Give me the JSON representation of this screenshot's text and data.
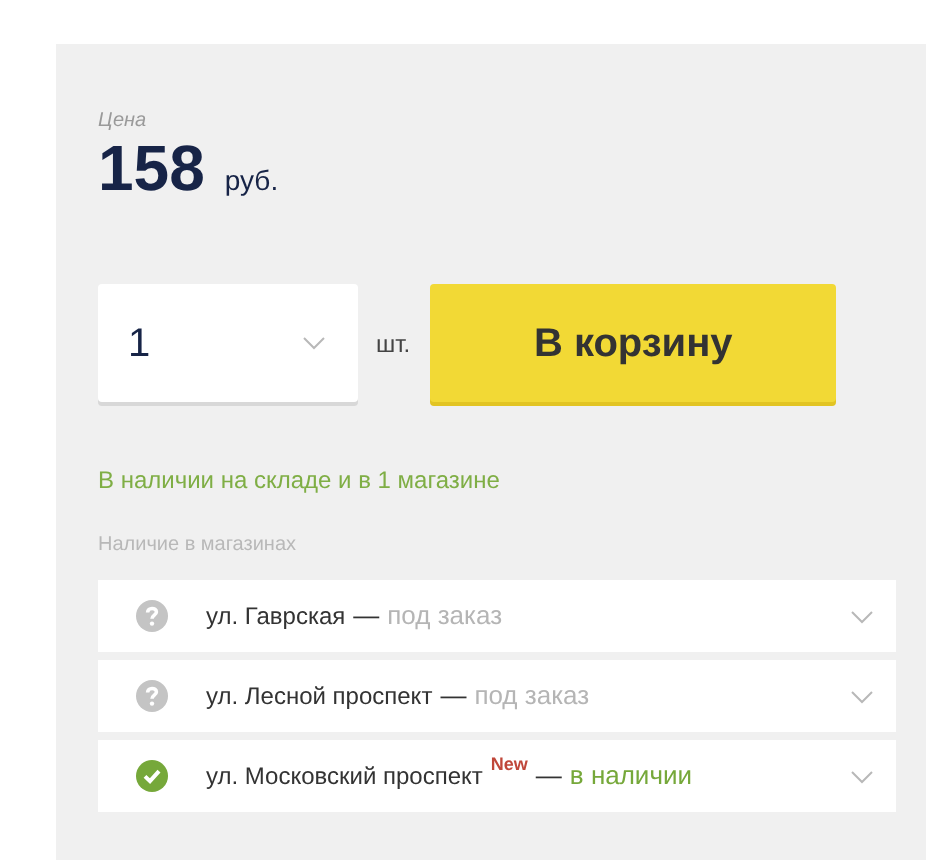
{
  "price": {
    "label": "Цена",
    "value": "158",
    "currency": "руб."
  },
  "quantity": {
    "value": "1",
    "unit": "шт."
  },
  "cart_button": "В корзину",
  "stock_summary": "В наличии на складе и в 1 магазине",
  "stores_heading": "Наличие в магазинах",
  "stores": [
    {
      "name": "ул. Гаврская",
      "dash": "—",
      "status": "под заказ",
      "kind": "order",
      "expanded": false
    },
    {
      "name": "ул. Лесной проспект",
      "dash": "—",
      "status": "под заказ",
      "kind": "order",
      "expanded": false
    },
    {
      "name": "ул. Московский проспект",
      "badge": "New",
      "dash": "—",
      "status": "в наличии",
      "kind": "available",
      "expanded": false
    }
  ]
}
